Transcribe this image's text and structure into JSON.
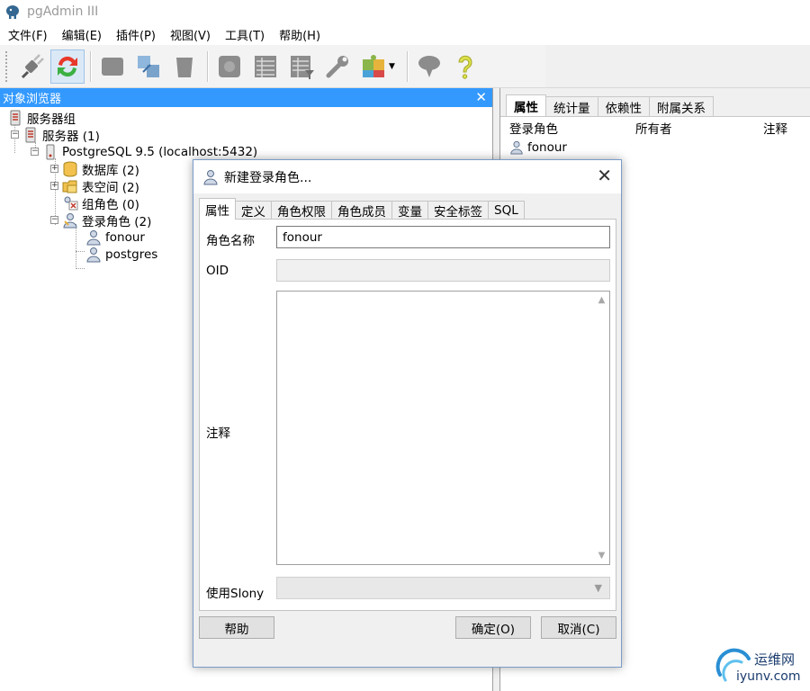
{
  "window": {
    "title": "pgAdmin III"
  },
  "menu": [
    "文件(F)",
    "编辑(E)",
    "插件(P)",
    "视图(V)",
    "工具(T)",
    "帮助(H)"
  ],
  "toolbar": {
    "icons": [
      "connect-icon",
      "refresh-icon",
      "properties-icon",
      "create-icon",
      "drop-icon",
      "sql-icon",
      "view-data-icon",
      "filtered-data-icon",
      "maintenance-icon",
      "plugin-icon",
      "guru-icon",
      "help-icon"
    ]
  },
  "object_browser": {
    "title": "对象浏览器",
    "close_glyph": "✕",
    "tree": [
      {
        "label": "服务器组",
        "icon": "server-group-icon",
        "level": 0
      },
      {
        "label": "服务器 (1)",
        "icon": "servers-icon",
        "level": 1
      },
      {
        "label": "PostgreSQL 9.5 (localhost:5432)",
        "icon": "server-icon",
        "level": 2
      },
      {
        "label": "数据库 (2)",
        "icon": "database-icon",
        "level": 3
      },
      {
        "label": "表空间 (2)",
        "icon": "tablespace-icon",
        "level": 3
      },
      {
        "label": "组角色 (0)",
        "icon": "group-role-icon",
        "level": 3
      },
      {
        "label": "登录角色 (2)",
        "icon": "login-roles-icon",
        "level": 3
      },
      {
        "label": "fonour",
        "icon": "user-icon",
        "level": 4
      },
      {
        "label": "postgres",
        "icon": "user-icon",
        "level": 4
      }
    ]
  },
  "right_panel": {
    "tabs": [
      "属性",
      "统计量",
      "依赖性",
      "附属关系"
    ],
    "columns": [
      "登录角色",
      "所有者",
      "注释"
    ],
    "rows": [
      {
        "name": "fonour"
      }
    ]
  },
  "dialog": {
    "title": "新建登录角色...",
    "close_glyph": "✕",
    "tabs": [
      "属性",
      "定义",
      "角色权限",
      "角色成员",
      "变量",
      "安全标签",
      "SQL"
    ],
    "fields": {
      "role_name_label": "角色名称",
      "role_name_value": "fonour",
      "oid_label": "OID",
      "oid_value": "",
      "comment_label": "注释",
      "slony_label": "使用Slony"
    },
    "buttons": {
      "help": "帮助",
      "ok": "确定(O)",
      "cancel": "取消(C)"
    }
  },
  "watermark": {
    "line1": "运维网",
    "line2": "iyunv.com"
  },
  "colors": {
    "panel_header": "#3399ff",
    "window_bg": "#f0f0f0"
  }
}
